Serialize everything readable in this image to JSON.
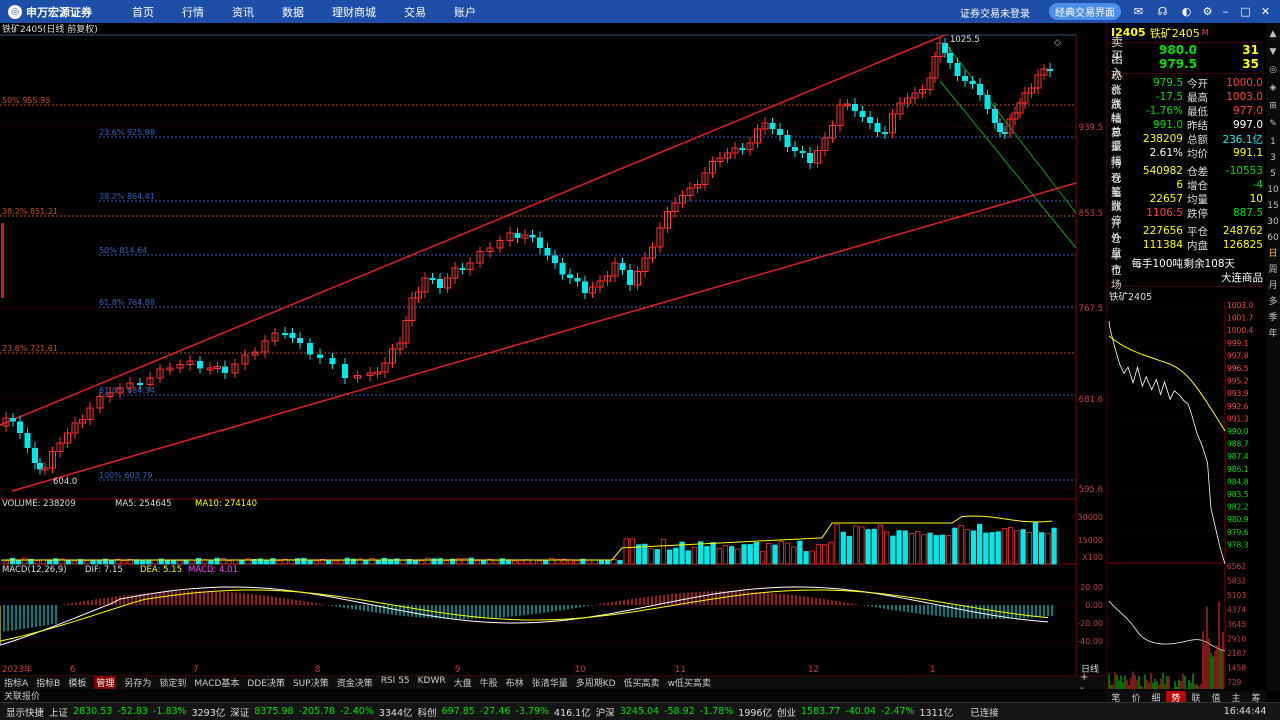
{
  "nav": {
    "brand": "申万宏源证券",
    "items": [
      "首页",
      "行情",
      "资讯",
      "数据",
      "理财商城",
      "交易",
      "账户"
    ],
    "login": "证券交易未登录",
    "classic": "经典交易界面"
  },
  "chart": {
    "title": "铁矿2405(日线 前复权)",
    "high_label": "1025.5",
    "low_label": "604.0",
    "fib": [
      "50% 955.95",
      "23.6% 925.98",
      "38.2% 864.41",
      "38.2% 851.21",
      "50% 814.64",
      "61.8% 764.88",
      "23.6% 721.61",
      "61.8% 684.34",
      "100% 603.79"
    ],
    "yticks": [
      "939.5",
      "853.5",
      "767.5",
      "681.6",
      "595.6"
    ],
    "volume": {
      "label": "VOLUME: 238209",
      "ma5": "MA5: 254645",
      "ma10": "MA10: 274140",
      "yticks": [
        "30000",
        "15000",
        "X100"
      ]
    },
    "macd": {
      "label": "MACD(12,26,9)",
      "dif": "DIF: 7.15",
      "dea": "DEA: 5.15",
      "macd": "MACD: 4.01",
      "yticks": [
        "20.00",
        "0.00",
        "-20.00",
        "-40.00"
      ]
    },
    "xticks": [
      "2023年",
      "6",
      "7",
      "8",
      "9",
      "10",
      "11",
      "12",
      "1"
    ],
    "xlabel": "日线"
  },
  "quote": {
    "code": "I2405",
    "name": "铁矿2405",
    "tag": "M",
    "sell": {
      "label": "卖出",
      "price": "980.0",
      "vol": "31"
    },
    "buy": {
      "label": "买入",
      "price": "979.5",
      "vol": "35"
    },
    "rows": [
      {
        "l": "现价",
        "v": "979.5",
        "l2": "今开",
        "v2": "1000.0"
      },
      {
        "l": "涨跌",
        "v": "-17.5",
        "l2": "最高",
        "v2": "1003.0"
      },
      {
        "l": "涨幅",
        "v": "-1.76%",
        "l2": "最低",
        "v2": "977.0"
      },
      {
        "l": "结算",
        "v": "991.0",
        "l2": "昨结",
        "v2": "997.0"
      },
      {
        "l": "总量",
        "v": "238209",
        "l2": "总额",
        "v2": "236.1亿"
      },
      {
        "l": "振幅",
        "v": "2.61%",
        "l2": "均价",
        "v2": "991.1"
      },
      {
        "l": "持仓",
        "v": "540982",
        "l2": "仓差",
        "v2": "-10553"
      },
      {
        "l": "现量",
        "v": "6",
        "l2": "增仓",
        "v2": "-4"
      },
      {
        "l": "笔数",
        "v": "22657",
        "l2": "均量",
        "v2": "10"
      },
      {
        "l": "涨停",
        "v": "1106.5",
        "l2": "跌停",
        "v2": "887.5"
      },
      {
        "l": "开仓",
        "v": "227656",
        "l2": "平仓",
        "v2": "248762"
      },
      {
        "l": "外盘",
        "v": "111384",
        "l2": "内盘",
        "v2": "126825"
      },
      {
        "l": "单位",
        "v": "每手100吨",
        "l2": "剩余108天",
        "v2": ""
      },
      {
        "l": "市场",
        "v": "",
        "l2": "",
        "v2": "大连商品"
      }
    ],
    "mini_title": "铁矿2405",
    "mini_yticks": [
      "1003.0",
      "1001.7",
      "1000.4",
      "999.1",
      "997.8",
      "996.5",
      "995.2",
      "993.9",
      "992.6",
      "991.3",
      "990.0",
      "988.7",
      "987.4",
      "986.1",
      "984.8",
      "983.5",
      "982.2",
      "980.9",
      "979.6",
      "978.3"
    ],
    "mini_vticks": [
      "6562",
      "5832",
      "5103",
      "4374",
      "3645",
      "2916",
      "2187",
      "1458",
      "729"
    ]
  },
  "sidebar": [
    "1",
    "3",
    "5",
    "10",
    "15",
    "30",
    "60",
    "日",
    "周",
    "月",
    "多",
    "季",
    "年"
  ],
  "tabs": [
    "指标A",
    "指标B",
    "模板",
    "管理",
    "另存为",
    "锁定到",
    "MACD基本",
    "DDE决策",
    "SUP决策",
    "资金决策",
    "RSI 55",
    "KDWR",
    "大盘",
    "牛股",
    "布林",
    "张清华量",
    "多周期KD",
    "低买高卖",
    "w低买高卖"
  ],
  "subtab": "关联报价",
  "rtabs": [
    "笔",
    "价",
    "细",
    "势",
    "联",
    "值",
    "主",
    "筹"
  ],
  "status": [
    "显示快捷",
    "上证",
    "2830.53",
    "-52.83",
    "-1.83%",
    "3293亿",
    "深证",
    "8375.98",
    "-205.78",
    "-2.40%",
    "3344亿",
    "科创",
    "697.85",
    "-27.46",
    "-3.79%",
    "416.1亿",
    "沪深",
    "3245.04",
    "-58.92",
    "-1.78%",
    "1996亿",
    "创业",
    "1583.77",
    "-40.04",
    "-2.47%",
    "1311亿",
    "已连接",
    "16:44:44"
  ]
}
